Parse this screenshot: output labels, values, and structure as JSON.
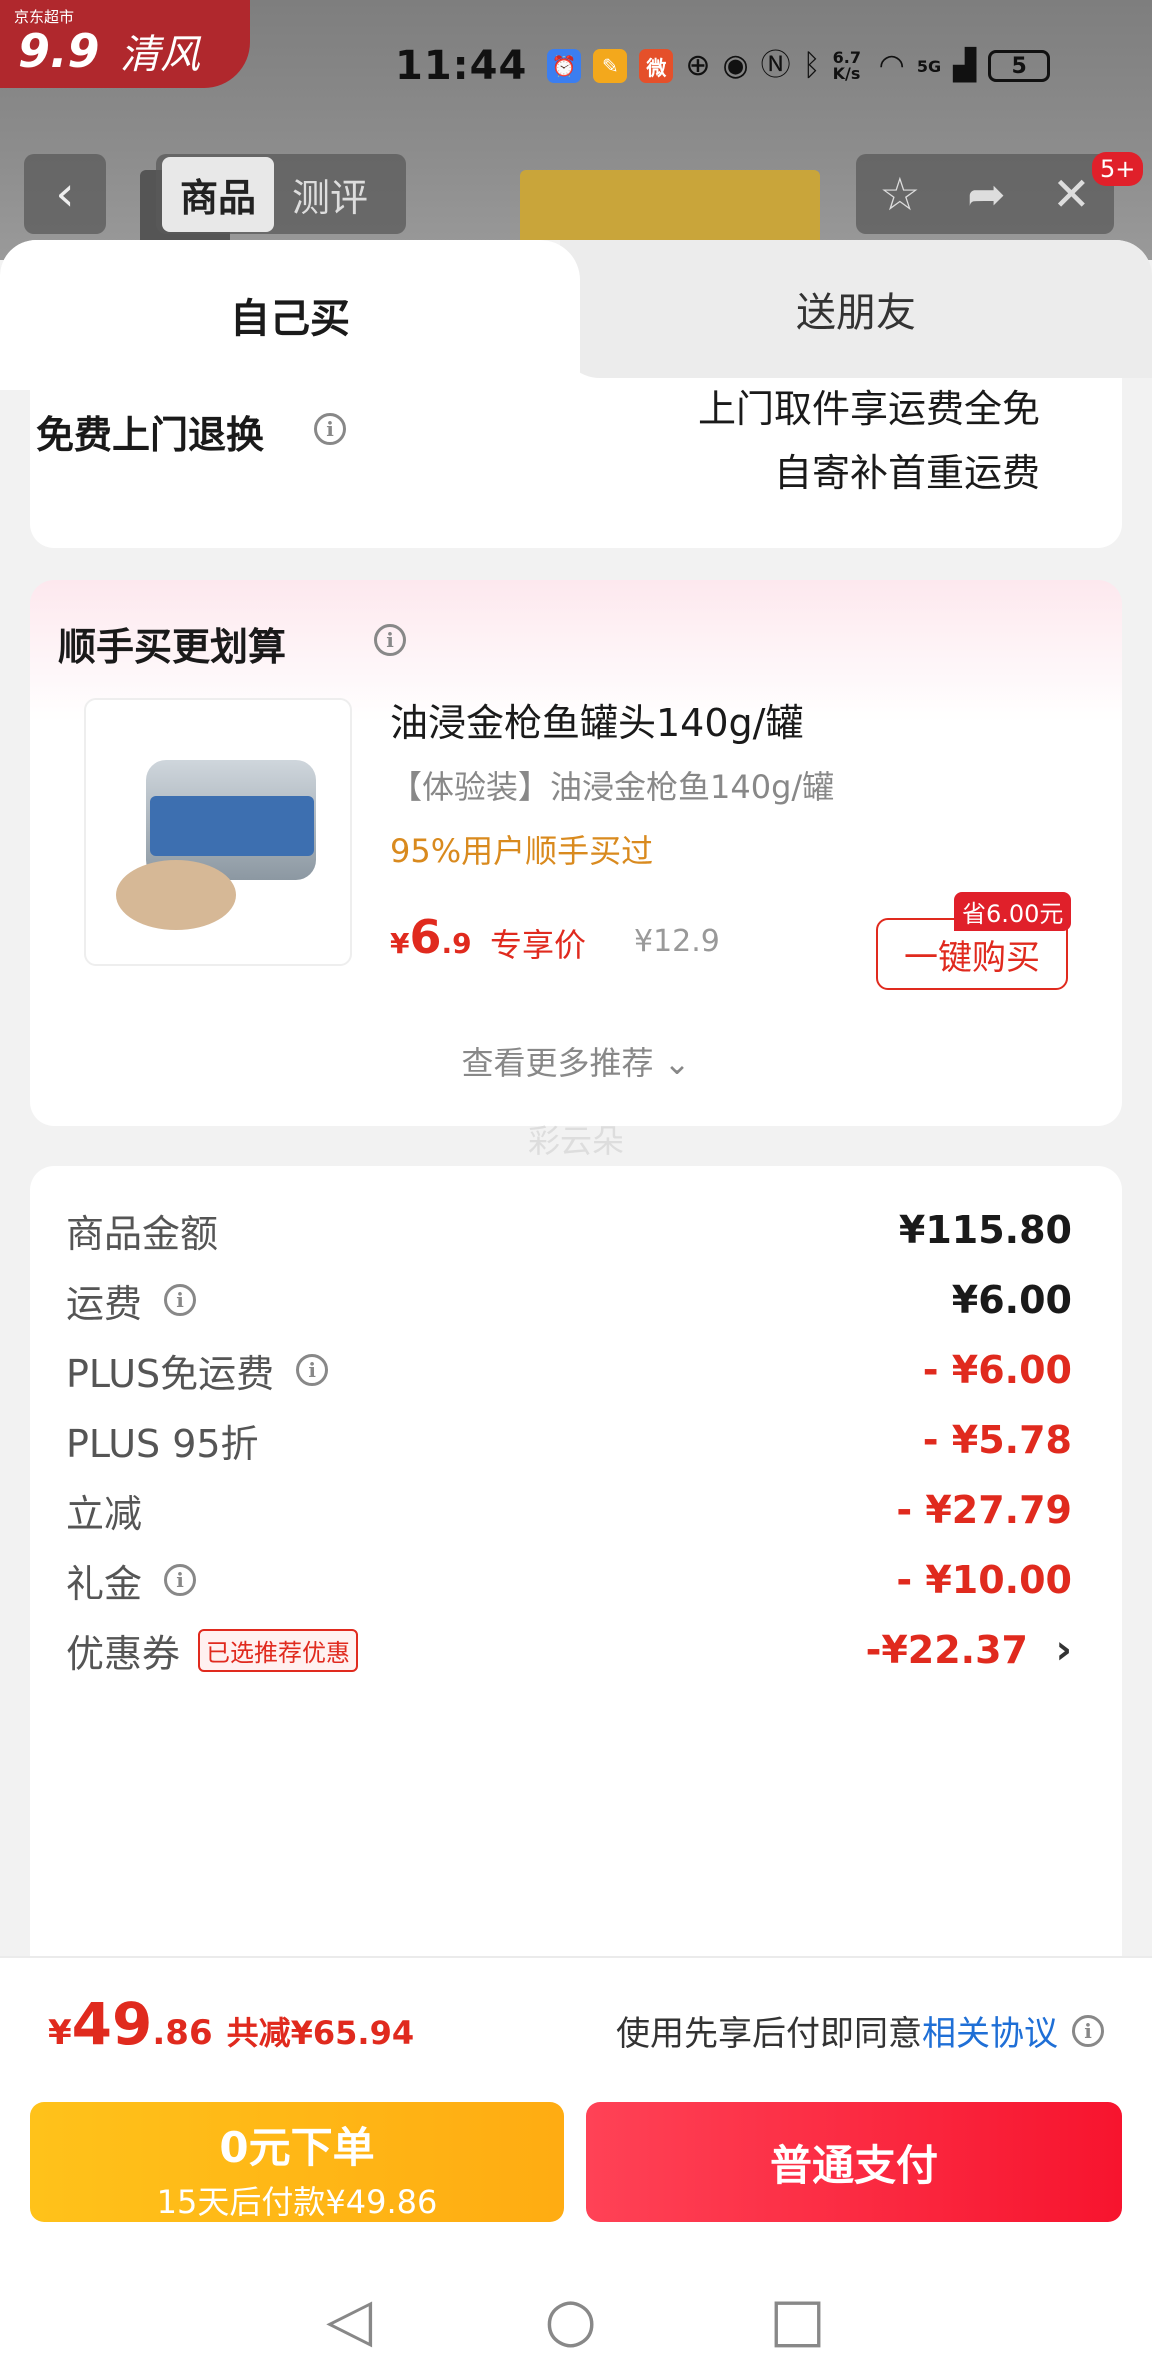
{
  "store": {
    "logo_small": "京东超市",
    "logo_text": "清风",
    "logo_num": "9.9"
  },
  "status_bar": {
    "time": "11:44",
    "network_speed": "6.7 K/s",
    "network": "5G",
    "battery": "5"
  },
  "header": {
    "tabs": [
      {
        "label": "商品",
        "active": true
      },
      {
        "label": "测评",
        "active": false
      }
    ],
    "badge": "5+"
  },
  "buy_tabs": {
    "self": "自己买",
    "friend": "送朋友"
  },
  "return_card": {
    "title": "免费上门退换",
    "line1": "上门取件享运费全免",
    "line2": "自寄补首重运费"
  },
  "recommend": {
    "title": "顺手买更划算",
    "product_name": "油浸金枪鱼罐头140g/罐",
    "product_sub": "【体验装】油浸金枪鱼140g/罐",
    "bought": "95%用户顺手买过",
    "price_symbol": "¥",
    "price_int": "6",
    "price_dec": ".9",
    "price_label": "专享价",
    "orig_price": "¥12.9",
    "save_tag": "省6.00元",
    "buy_label": "一键购买",
    "more_label": "查看更多推荐 ⌄",
    "watermark": "彩云朵"
  },
  "price_rows": [
    {
      "label": "商品金额",
      "value": "¥115.80",
      "info": false,
      "red": false
    },
    {
      "label": "运费",
      "value": "¥6.00",
      "info": true,
      "red": false
    },
    {
      "label": "PLUS免运费",
      "value": "- ¥6.00",
      "info": true,
      "red": true
    },
    {
      "label": "PLUS 95折",
      "value": "- ¥5.78",
      "info": false,
      "red": true
    },
    {
      "label": "立减",
      "value": "- ¥27.79",
      "info": false,
      "red": true
    },
    {
      "label": "礼金",
      "value": "- ¥10.00",
      "info": true,
      "red": true
    }
  ],
  "coupon": {
    "label": "优惠券",
    "tag": "已选推荐优惠",
    "value": "-¥22.37"
  },
  "footer": {
    "total_symbol": "¥",
    "total_int": "49",
    "total_dec": ".86",
    "total_save": "共减¥65.94",
    "agree_text": "使用先享后付即同意",
    "agree_link": "相关协议",
    "later_l1": "0元下单",
    "later_l2": "15天后付款¥49.86",
    "pay_label": "普通支付"
  },
  "colors": {
    "accent_red": "#e02a1e",
    "later_yellow": "#ffb814",
    "pay_red": "#f7142e",
    "link_blue": "#1f6fd6"
  }
}
